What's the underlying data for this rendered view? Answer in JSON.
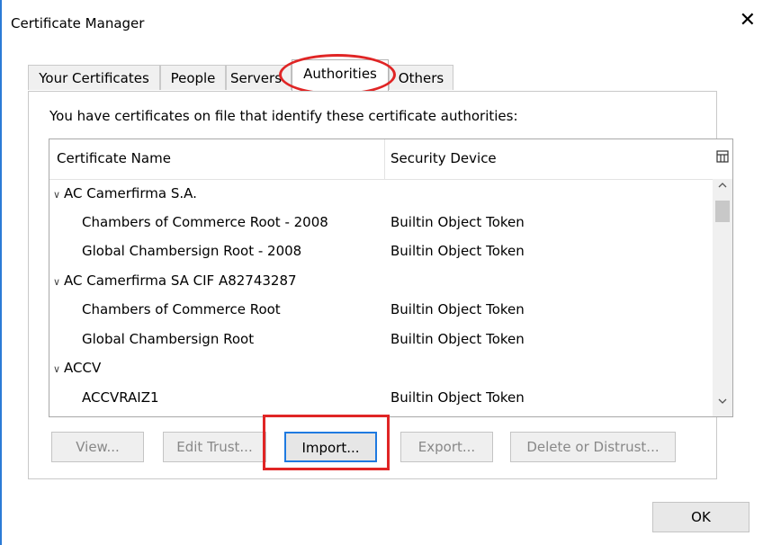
{
  "window": {
    "title": "Certificate Manager",
    "close_glyph": "✕"
  },
  "tabs": [
    {
      "label": "Your Certificates"
    },
    {
      "label": "People"
    },
    {
      "label": "Servers"
    },
    {
      "label": "Authorities"
    },
    {
      "label": "Others"
    }
  ],
  "panel": {
    "description": "You have certificates on file that identify these certificate authorities:",
    "columns": {
      "name": "Certificate Name",
      "device": "Security Device",
      "picker_icon": "column-picker-icon"
    },
    "rows": [
      {
        "name": "AC Camerfirma S.A.",
        "device": "",
        "group": true,
        "expanded_glyph": "∨"
      },
      {
        "name": "Chambers of Commerce Root - 2008",
        "device": "Builtin Object Token",
        "group": false
      },
      {
        "name": "Global Chambersign Root - 2008",
        "device": "Builtin Object Token",
        "group": false
      },
      {
        "name": "AC Camerfirma SA CIF A82743287",
        "device": "",
        "group": true,
        "expanded_glyph": "∨"
      },
      {
        "name": "Chambers of Commerce Root",
        "device": "Builtin Object Token",
        "group": false
      },
      {
        "name": "Global Chambersign Root",
        "device": "Builtin Object Token",
        "group": false
      },
      {
        "name": "ACCV",
        "device": "",
        "group": true,
        "expanded_glyph": "∨"
      },
      {
        "name": "ACCVRAIZ1",
        "device": "Builtin Object Token",
        "group": false
      }
    ],
    "buttons": {
      "view": "View...",
      "edit_trust": "Edit Trust...",
      "import": "Import...",
      "export": "Export...",
      "delete": "Delete or Distrust..."
    }
  },
  "footer": {
    "ok": "OK"
  },
  "colors": {
    "annotation_red": "#e02525",
    "focus_blue": "#1f7ae0",
    "window_border": "#2b7bd6"
  }
}
